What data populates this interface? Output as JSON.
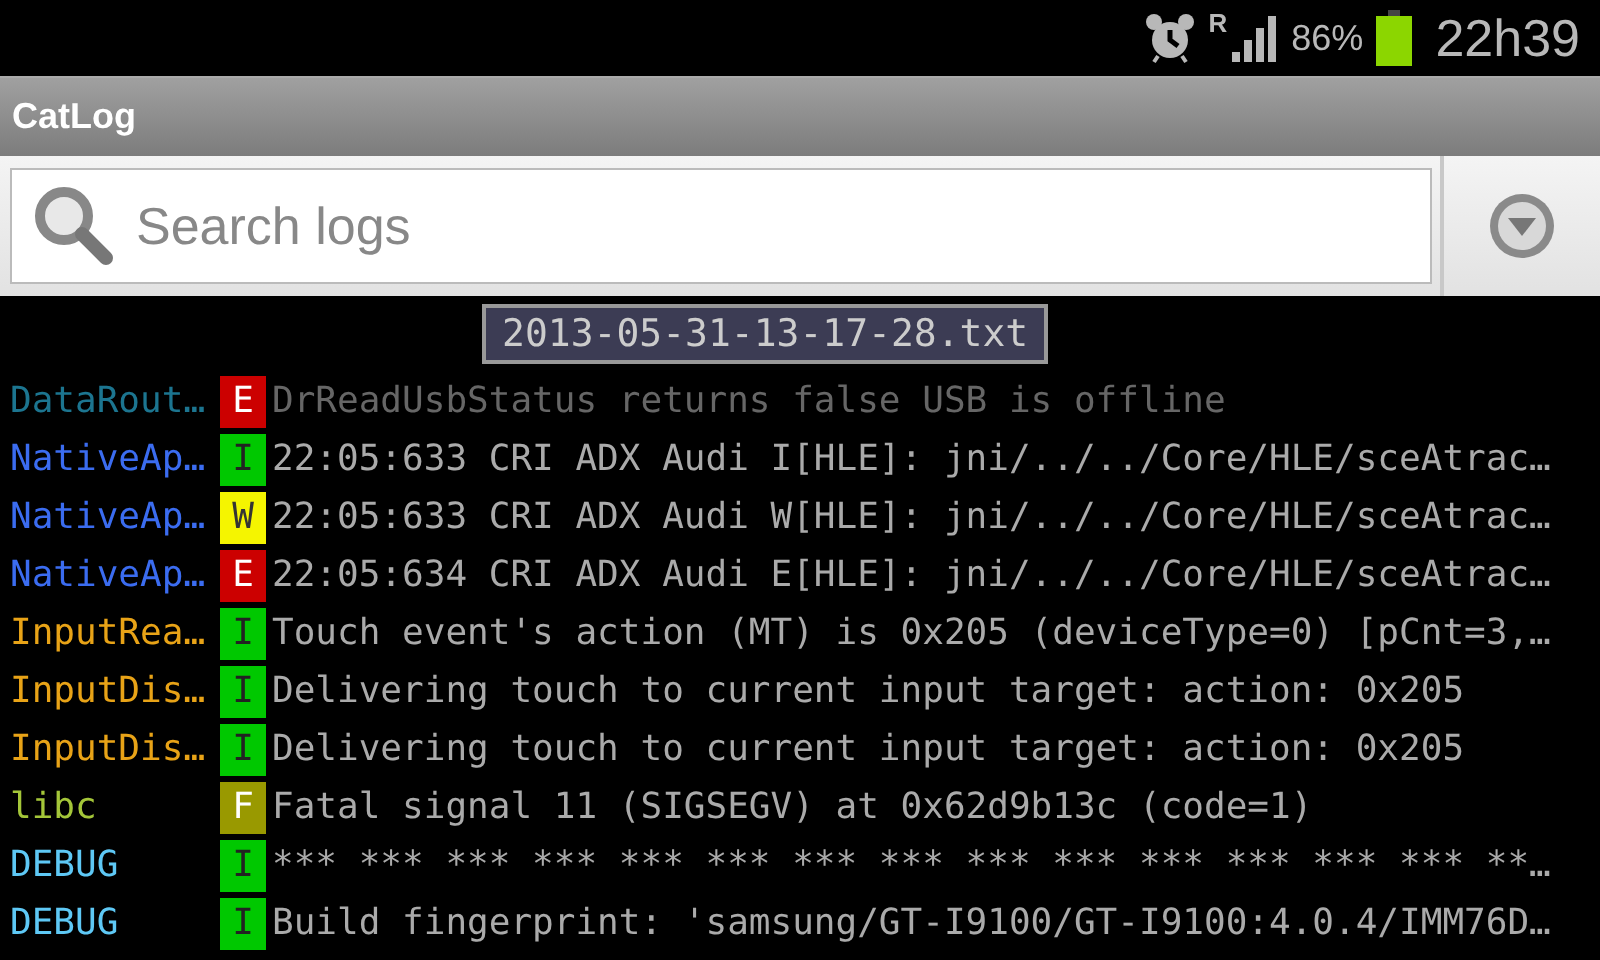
{
  "status_bar": {
    "roaming": "R",
    "battery": "86%",
    "time": "22h39"
  },
  "app_bar": {
    "title": "CatLog"
  },
  "search": {
    "placeholder": "Search logs"
  },
  "toast": "2013-05-31-13-17-28.txt",
  "log": [
    {
      "tag": "DataRout…",
      "color": "#1c7590",
      "kind": "error",
      "priority": "E",
      "message": "DrReadUsbStatus returns false USB is offline"
    },
    {
      "tag": "NativeAp…",
      "color": "#3b6cf0",
      "kind": "info",
      "priority": "I",
      "message": "22:05:633 CRI ADX Audi I[HLE]: jni/../../Core/HLE/sceAtrac…"
    },
    {
      "tag": "NativeAp…",
      "color": "#3b6cf0",
      "kind": "warn",
      "priority": "W",
      "message": "22:05:633 CRI ADX Audi W[HLE]: jni/../../Core/HLE/sceAtrac…"
    },
    {
      "tag": "NativeAp…",
      "color": "#3b6cf0",
      "kind": "error",
      "priority": "E",
      "message": "22:05:634 CRI ADX Audi E[HLE]: jni/../../Core/HLE/sceAtrac…"
    },
    {
      "tag": "InputRea…",
      "color": "#e8a317",
      "kind": "info",
      "priority": "I",
      "message": "Touch event's action (MT) is 0x205 (deviceType=0) [pCnt=3,…"
    },
    {
      "tag": "InputDis…",
      "color": "#e8a317",
      "kind": "info",
      "priority": "I",
      "message": "Delivering touch to current input target: action: 0x205"
    },
    {
      "tag": "InputDis…",
      "color": "#e8a317",
      "kind": "info",
      "priority": "I",
      "message": "Delivering touch to current input target: action: 0x205"
    },
    {
      "tag": "libc",
      "color": "#a4c639",
      "kind": "fatal",
      "priority": "F",
      "message": "Fatal signal 11 (SIGSEGV) at 0x62d9b13c (code=1)"
    },
    {
      "tag": "DEBUG",
      "color": "#5ec8f5",
      "kind": "info",
      "priority": "I",
      "message": "*** *** *** *** *** *** *** *** *** *** *** *** *** *** **…"
    },
    {
      "tag": "DEBUG",
      "color": "#5ec8f5",
      "kind": "info",
      "priority": "I",
      "message": "Build fingerprint: 'samsung/GT-I9100/GT-I9100:4.0.4/IMM76D…"
    }
  ]
}
